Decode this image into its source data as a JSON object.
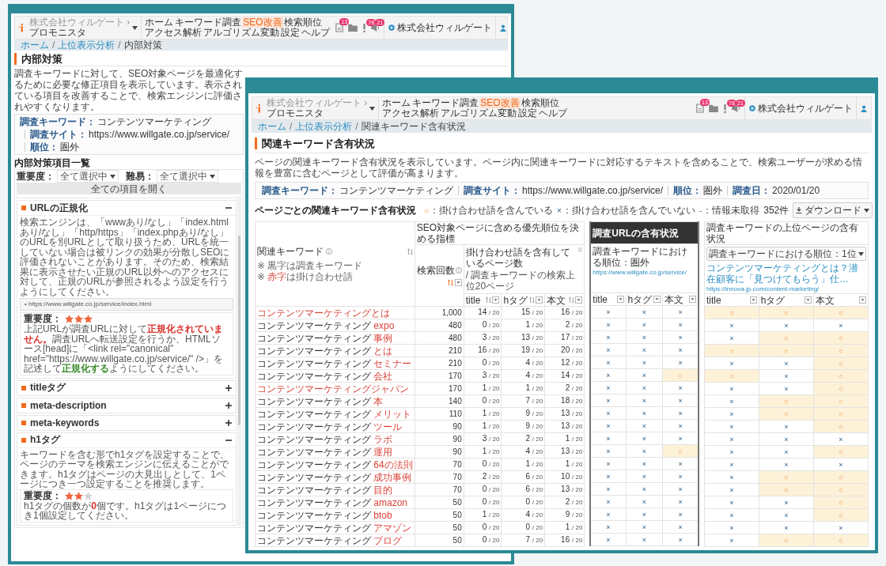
{
  "back_window": {
    "header": {
      "company": "株式会社ウィルゲート ›",
      "product": "プロモニスタ",
      "nav": [
        {
          "label": "ホーム",
          "selected": false
        },
        {
          "label": "キーワード調査",
          "selected": false
        },
        {
          "label": "SEO改善",
          "selected": true
        },
        {
          "label": "検索順位",
          "selected": false
        },
        {
          "label": "アクセス解析",
          "selected": false
        },
        {
          "label": "アルゴリズム変動",
          "selected": false
        },
        {
          "label": "設定",
          "selected": false
        },
        {
          "label": "ヘルプ",
          "selected": false
        }
      ],
      "icons": [
        {
          "kind": "document",
          "badge": "13"
        },
        {
          "kind": "folder"
        },
        {
          "kind": "alert",
          "badge": "78"
        },
        {
          "kind": "megaphone",
          "badge": "21"
        }
      ],
      "account": "株式会社ウィルゲート"
    },
    "breadcrumb": [
      {
        "label": "ホーム",
        "current": false
      },
      {
        "sep": "/",
        "label": "上位表示分析",
        "current": false
      },
      {
        "sep": "/",
        "label": "内部対策",
        "current": true
      }
    ],
    "title": "内部対策",
    "description": "調査キーワードに対して、SEO対象ページを最適化するために必要な修正項目を表示しています。表示されている項目を改善することで、検索エンジンに評価されやすくなります。",
    "info": [
      {
        "label": "調査キーワード：",
        "value": "コンテンツマーケティング"
      },
      {
        "label": "調査サイト：",
        "value": "https://www.willgate.co.jp/service/"
      },
      {
        "label": "順位：",
        "value": "圏外"
      }
    ],
    "list_title": "内部対策項目一覧",
    "filters": [
      {
        "label": "重要度：",
        "value": "全て選択中"
      },
      {
        "label": "難易：",
        "value": "全て選択中"
      }
    ],
    "expand_all": "全ての項目を開く",
    "items": [
      {
        "title": "URLの正規化",
        "expanded": true,
        "text": "検索エンジンは、「wwwあり/なし」「index.htmlあり/なし」「http/https」「index.phpあり/なし」のURLを別URLとして取り扱うため、URLを統一していない場合は被リンクの効果が分散しSEOに評価されないことがあります。そのため、検索結果に表示させたい正規のURL以外へのアクセスに対して、正規のURLが参照されるよう設定を行うようにしてください。",
        "url": "• https://www.willgate.co.jp/service/index.html",
        "importance": {
          "label": "重要度：",
          "stars": 3,
          "message": [
            {
              "text": "上記URLが調査URLに対して",
              "kind": "plain"
            },
            {
              "text": "正規化されていません。",
              "kind": "error"
            },
            {
              "text": "調査URLへ転送設定を行うか、HTMLソース[head]に「<link rel=\"canonical\" href=\"https://www.willgate.co.jp/service/\" />」を記述して",
              "kind": "plain"
            },
            {
              "text": "正規化する",
              "kind": "good"
            },
            {
              "text": "ようにしてください。",
              "kind": "plain"
            }
          ]
        }
      },
      {
        "title": "titleタグ",
        "expanded": false
      },
      {
        "title": "meta-description",
        "expanded": false
      },
      {
        "title": "meta-keywords",
        "expanded": false
      },
      {
        "title": "h1タグ",
        "expanded": true,
        "text": "キーワードを含む形でh1タグを設定することで、ページのテーマを検索エンジンに伝えることができます。h1タグはページの大見出しとして、1ページにつき一つ設定することを推奨します。",
        "importance": {
          "label": "重要度：",
          "stars": 2,
          "message": [
            {
              "text": "h1タグの個数が",
              "kind": "plain"
            },
            {
              "text": "0",
              "kind": "error"
            },
            {
              "text": "個です。h1タグは1ページにつき1個設定してください。",
              "kind": "plain"
            }
          ]
        }
      }
    ]
  },
  "front_window": {
    "header": {
      "company": "株式会社ウィルゲート ›",
      "product": "プロモニスタ",
      "nav": [
        {
          "label": "ホーム",
          "selected": false
        },
        {
          "label": "キーワード調査",
          "selected": false
        },
        {
          "label": "SEO改善",
          "selected": true
        },
        {
          "label": "検索順位",
          "selected": false
        },
        {
          "label": "アクセス解析",
          "selected": false
        },
        {
          "label": "アルゴリズム変動",
          "selected": false
        },
        {
          "label": "設定",
          "selected": false
        },
        {
          "label": "ヘルプ",
          "selected": false
        }
      ],
      "icons": [
        {
          "kind": "document",
          "badge": "13"
        },
        {
          "kind": "folder"
        },
        {
          "kind": "alert",
          "badge": "78"
        },
        {
          "kind": "megaphone",
          "badge": "21"
        }
      ],
      "account": "株式会社ウィルゲート"
    },
    "breadcrumb": [
      {
        "label": "ホーム",
        "current": false
      },
      {
        "sep": "/",
        "label": "上位表示分析",
        "current": false
      },
      {
        "sep": "/",
        "label": "関連キーワード含有状況",
        "current": true
      }
    ],
    "title": "関連キーワード含有状況",
    "description": "ページの関連キーワード含有状況を表示しています。ページ内に関連キーワードに対応するテキストを含めることで、検索ユーザーが求める情報を豊富に含むページとして評価が高まります。",
    "info": [
      {
        "label": "調査キーワード：",
        "value": "コンテンツマーケティング"
      },
      {
        "label": "調査サイト：",
        "value": "https://www.willgate.co.jp/service/"
      },
      {
        "label": "順位：",
        "value": "圏外"
      },
      {
        "label": "調査日：",
        "value": "2020/01/20"
      }
    ],
    "section_title": "ページごとの関連キーワード含有状況",
    "legend": [
      {
        "symbol": "○",
        "text": "：掛け合わせ語を含んでいる",
        "kind": "contains"
      },
      {
        "symbol": "×",
        "text": "：掛け合わせ語を含んでいない",
        "kind": "missing"
      },
      {
        "symbol": "-",
        "text": "：情報未取得",
        "kind": "unknown"
      }
    ],
    "count": "352件",
    "download": "ダウンロード",
    "table": {
      "keyword_header": {
        "label": "関連キーワード",
        "sorted": false,
        "notes": [
          [
            {
              "text": "※ 黒字は調査キーワード",
              "red": false
            }
          ],
          [
            {
              "text": "※ ",
              "red": false
            },
            {
              "text": "赤字",
              "red": true
            },
            {
              "text": "は掛け合わせ語",
              "red": false
            }
          ]
        ]
      },
      "metrics_group": "SEO対象ページに含める優先順位を決める指標",
      "search_header": {
        "label": "検索回数",
        "sorted": true
      },
      "pages_header": {
        "label": "掛け合わせ語を含有しているページ数",
        "note": "/ 調査キーワードの検索上位20ページ"
      },
      "page_columns": [
        {
          "label": "title",
          "sorted": false
        },
        {
          "label": "hタグ",
          "sorted": false
        },
        {
          "label": "本文",
          "sorted": false
        }
      ],
      "url_group": {
        "title": "調査URLの含有状況",
        "rank": "調査キーワードにおける順位：圏外",
        "link": "https://www.willgate.co.jp/service/",
        "columns": [
          "title",
          "hタグ",
          "本文"
        ]
      },
      "top_group": {
        "title": "調査キーワードの上位ページの含有状況",
        "rank": "調査キーワードにおける順位：1位",
        "link_title": "コンテンツマーケティングとは？潜在顧客に「見つけてもらう」仕…",
        "link": "https://innova-jp.com/content-marketing/",
        "columns": [
          "title",
          "hタグ",
          "本文"
        ]
      },
      "rows": [
        {
          "term": "コンテンツマーケティングとは",
          "searches": "1,000",
          "pages": [
            [
              "14",
              "/ 20"
            ],
            [
              "15",
              "/ 20"
            ],
            [
              "16",
              "/ 20"
            ]
          ],
          "url": [
            {
              "mark": "×",
              "contains": false
            },
            {
              "mark": "×",
              "contains": false
            },
            {
              "mark": "×",
              "contains": false
            }
          ],
          "top": [
            {
              "mark": "○",
              "contains": true
            },
            {
              "mark": "○",
              "contains": true
            },
            {
              "mark": "○",
              "contains": true
            }
          ]
        },
        {
          "keyword": "コンテンツマーケティング",
          "term": "expo",
          "searches": "480",
          "pages": [
            [
              "0",
              "/ 20"
            ],
            [
              "1",
              "/ 20"
            ],
            [
              "2",
              "/ 20"
            ]
          ],
          "url": [
            {
              "mark": "×",
              "contains": false
            },
            {
              "mark": "×",
              "contains": false
            },
            {
              "mark": "×",
              "contains": false
            }
          ],
          "top": [
            {
              "mark": "×",
              "contains": false
            },
            {
              "mark": "×",
              "contains": false
            },
            {
              "mark": "×",
              "contains": false
            }
          ]
        },
        {
          "keyword": "コンテンツマーケティング",
          "term": "事例",
          "searches": "480",
          "pages": [
            [
              "3",
              "/ 20"
            ],
            [
              "13",
              "/ 20"
            ],
            [
              "17",
              "/ 20"
            ]
          ],
          "url": [
            {
              "mark": "×",
              "contains": false
            },
            {
              "mark": "×",
              "contains": false
            },
            {
              "mark": "×",
              "contains": false
            }
          ],
          "top": [
            {
              "mark": "×",
              "contains": false
            },
            {
              "mark": "○",
              "contains": true
            },
            {
              "mark": "○",
              "contains": true
            }
          ]
        },
        {
          "keyword": "コンテンツマーケティング",
          "term": "とは",
          "searches": "210",
          "pages": [
            [
              "16",
              "/ 20"
            ],
            [
              "19",
              "/ 20"
            ],
            [
              "20",
              "/ 20"
            ]
          ],
          "url": [
            {
              "mark": "×",
              "contains": false
            },
            {
              "mark": "×",
              "contains": false
            },
            {
              "mark": "×",
              "contains": false
            }
          ],
          "top": [
            {
              "mark": "○",
              "contains": true
            },
            {
              "mark": "○",
              "contains": true
            },
            {
              "mark": "○",
              "contains": true
            }
          ]
        },
        {
          "keyword": "コンテンツマーケティング",
          "term": "セミナー",
          "searches": "210",
          "pages": [
            [
              "0",
              "/ 20"
            ],
            [
              "4",
              "/ 20"
            ],
            [
              "12",
              "/ 20"
            ]
          ],
          "url": [
            {
              "mark": "×",
              "contains": false
            },
            {
              "mark": "×",
              "contains": false
            },
            {
              "mark": "×",
              "contains": false
            }
          ],
          "top": [
            {
              "mark": "×",
              "contains": false
            },
            {
              "mark": "×",
              "contains": false
            },
            {
              "mark": "○",
              "contains": true
            }
          ]
        },
        {
          "keyword": "コンテンツマーケティング",
          "term": "会社",
          "searches": "170",
          "pages": [
            [
              "3",
              "/ 20"
            ],
            [
              "4",
              "/ 20"
            ],
            [
              "14",
              "/ 20"
            ]
          ],
          "url": [
            {
              "mark": "×",
              "contains": false
            },
            {
              "mark": "×",
              "contains": false
            },
            {
              "mark": "○",
              "contains": true
            }
          ],
          "top": [
            {
              "mark": "○",
              "contains": true
            },
            {
              "mark": "×",
              "contains": false
            },
            {
              "mark": "○",
              "contains": true
            }
          ]
        },
        {
          "term": "コンテンツマーケティングジャパン",
          "searches": "170",
          "pages": [
            [
              "1",
              "/ 20"
            ],
            [
              "1",
              "/ 20"
            ],
            [
              "2",
              "/ 20"
            ]
          ],
          "url": [
            {
              "mark": "×",
              "contains": false
            },
            {
              "mark": "×",
              "contains": false
            },
            {
              "mark": "×",
              "contains": false
            }
          ],
          "top": [
            {
              "mark": "×",
              "contains": false
            },
            {
              "mark": "×",
              "contains": false
            },
            {
              "mark": "○",
              "contains": true
            }
          ]
        },
        {
          "keyword": "コンテンツマーケティング",
          "term": "本",
          "searches": "140",
          "pages": [
            [
              "0",
              "/ 20"
            ],
            [
              "7",
              "/ 20"
            ],
            [
              "18",
              "/ 20"
            ]
          ],
          "url": [
            {
              "mark": "×",
              "contains": false
            },
            {
              "mark": "×",
              "contains": false
            },
            {
              "mark": "×",
              "contains": false
            }
          ],
          "top": [
            {
              "mark": "×",
              "contains": false
            },
            {
              "mark": "○",
              "contains": true
            },
            {
              "mark": "○",
              "contains": true
            }
          ]
        },
        {
          "keyword": "コンテンツマーケティング",
          "term": "メリット",
          "searches": "110",
          "pages": [
            [
              "1",
              "/ 20"
            ],
            [
              "9",
              "/ 20"
            ],
            [
              "13",
              "/ 20"
            ]
          ],
          "url": [
            {
              "mark": "×",
              "contains": false
            },
            {
              "mark": "×",
              "contains": false
            },
            {
              "mark": "×",
              "contains": false
            }
          ],
          "top": [
            {
              "mark": "×",
              "contains": false
            },
            {
              "mark": "○",
              "contains": true
            },
            {
              "mark": "○",
              "contains": true
            }
          ]
        },
        {
          "keyword": "コンテンツマーケティング",
          "term": "ツール",
          "searches": "90",
          "pages": [
            [
              "1",
              "/ 20"
            ],
            [
              "9",
              "/ 20"
            ],
            [
              "13",
              "/ 20"
            ]
          ],
          "url": [
            {
              "mark": "×",
              "contains": false
            },
            {
              "mark": "×",
              "contains": false
            },
            {
              "mark": "×",
              "contains": false
            }
          ],
          "top": [
            {
              "mark": "×",
              "contains": false
            },
            {
              "mark": "×",
              "contains": false
            },
            {
              "mark": "○",
              "contains": true
            }
          ]
        },
        {
          "keyword": "コンテンツマーケティング",
          "term": "ラボ",
          "searches": "90",
          "pages": [
            [
              "3",
              "/ 20"
            ],
            [
              "2",
              "/ 20"
            ],
            [
              "1",
              "/ 20"
            ]
          ],
          "url": [
            {
              "mark": "×",
              "contains": false
            },
            {
              "mark": "×",
              "contains": false
            },
            {
              "mark": "×",
              "contains": false
            }
          ],
          "top": [
            {
              "mark": "×",
              "contains": false
            },
            {
              "mark": "×",
              "contains": false
            },
            {
              "mark": "×",
              "contains": false
            }
          ]
        },
        {
          "keyword": "コンテンツマーケティング",
          "term": "運用",
          "searches": "90",
          "pages": [
            [
              "1",
              "/ 20"
            ],
            [
              "4",
              "/ 20"
            ],
            [
              "13",
              "/ 20"
            ]
          ],
          "url": [
            {
              "mark": "×",
              "contains": false
            },
            {
              "mark": "×",
              "contains": false
            },
            {
              "mark": "○",
              "contains": true
            }
          ],
          "top": [
            {
              "mark": "×",
              "contains": false
            },
            {
              "mark": "×",
              "contains": false
            },
            {
              "mark": "○",
              "contains": true
            }
          ]
        },
        {
          "keyword": "コンテンツマーケティング",
          "term": "64の法則",
          "searches": "70",
          "pages": [
            [
              "0",
              "/ 20"
            ],
            [
              "1",
              "/ 20"
            ],
            [
              "1",
              "/ 20"
            ]
          ],
          "url": [
            {
              "mark": "×",
              "contains": false
            },
            {
              "mark": "×",
              "contains": false
            },
            {
              "mark": "×",
              "contains": false
            }
          ],
          "top": [
            {
              "mark": "×",
              "contains": false
            },
            {
              "mark": "×",
              "contains": false
            },
            {
              "mark": "×",
              "contains": false
            }
          ]
        },
        {
          "keyword": "コンテンツマーケティング",
          "term": "成功事例",
          "searches": "70",
          "pages": [
            [
              "2",
              "/ 20"
            ],
            [
              "6",
              "/ 20"
            ],
            [
              "10",
              "/ 20"
            ]
          ],
          "url": [
            {
              "mark": "×",
              "contains": false
            },
            {
              "mark": "×",
              "contains": false
            },
            {
              "mark": "×",
              "contains": false
            }
          ],
          "top": [
            {
              "mark": "×",
              "contains": false
            },
            {
              "mark": "○",
              "contains": true
            },
            {
              "mark": "○",
              "contains": true
            }
          ]
        },
        {
          "keyword": "コンテンツマーケティング",
          "term": "目的",
          "searches": "70",
          "pages": [
            [
              "0",
              "/ 20"
            ],
            [
              "6",
              "/ 20"
            ],
            [
              "13",
              "/ 20"
            ]
          ],
          "url": [
            {
              "mark": "×",
              "contains": false
            },
            {
              "mark": "×",
              "contains": false
            },
            {
              "mark": "×",
              "contains": false
            }
          ],
          "top": [
            {
              "mark": "×",
              "contains": false
            },
            {
              "mark": "○",
              "contains": true
            },
            {
              "mark": "○",
              "contains": true
            }
          ]
        },
        {
          "keyword": "コンテンツマーケティング",
          "term": "amazon",
          "searches": "50",
          "pages": [
            [
              "0",
              "/ 20"
            ],
            [
              "0",
              "/ 20"
            ],
            [
              "2",
              "/ 20"
            ]
          ],
          "url": [
            {
              "mark": "×",
              "contains": false
            },
            {
              "mark": "×",
              "contains": false
            },
            {
              "mark": "×",
              "contains": false
            }
          ],
          "top": [
            {
              "mark": "×",
              "contains": false
            },
            {
              "mark": "×",
              "contains": false
            },
            {
              "mark": "○",
              "contains": true
            }
          ]
        },
        {
          "keyword": "コンテンツマーケティング",
          "term": "btob",
          "searches": "50",
          "pages": [
            [
              "1",
              "/ 20"
            ],
            [
              "4",
              "/ 20"
            ],
            [
              "9",
              "/ 20"
            ]
          ],
          "url": [
            {
              "mark": "×",
              "contains": false
            },
            {
              "mark": "×",
              "contains": false
            },
            {
              "mark": "×",
              "contains": false
            }
          ],
          "top": [
            {
              "mark": "×",
              "contains": false
            },
            {
              "mark": "×",
              "contains": false
            },
            {
              "mark": "○",
              "contains": true
            }
          ]
        },
        {
          "keyword": "コンテンツマーケティング",
          "term": "アマゾン",
          "searches": "50",
          "pages": [
            [
              "0",
              "/ 20"
            ],
            [
              "0",
              "/ 20"
            ],
            [
              "1",
              "/ 20"
            ]
          ],
          "url": [
            {
              "mark": "×",
              "contains": false
            },
            {
              "mark": "×",
              "contains": false
            },
            {
              "mark": "×",
              "contains": false
            }
          ],
          "top": [
            {
              "mark": "×",
              "contains": false
            },
            {
              "mark": "×",
              "contains": false
            },
            {
              "mark": "×",
              "contains": false
            }
          ]
        },
        {
          "keyword": "コンテンツマーケティング",
          "term": "ブログ",
          "searches": "50",
          "pages": [
            [
              "0",
              "/ 20"
            ],
            [
              "7",
              "/ 20"
            ],
            [
              "16",
              "/ 20"
            ]
          ],
          "url": [
            {
              "mark": "×",
              "contains": false
            },
            {
              "mark": "×",
              "contains": false
            },
            {
              "mark": "×",
              "contains": false
            }
          ],
          "top": [
            {
              "mark": "×",
              "contains": false
            },
            {
              "mark": "○",
              "contains": true
            },
            {
              "mark": "○",
              "contains": true
            }
          ]
        }
      ]
    }
  }
}
